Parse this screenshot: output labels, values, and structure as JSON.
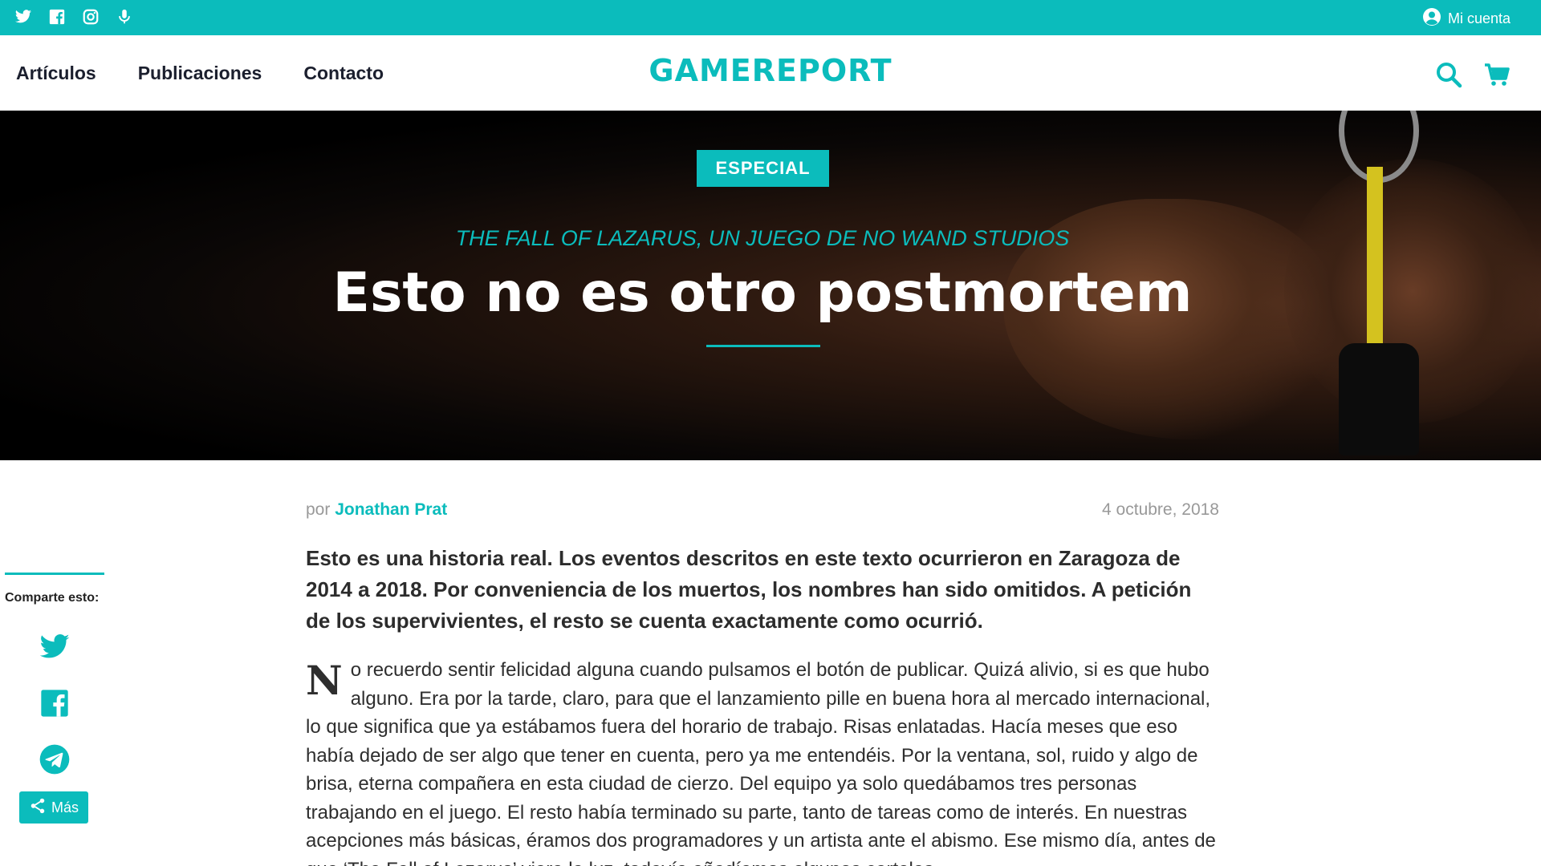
{
  "topbar": {
    "social_icons": [
      "twitter-icon",
      "facebook-icon",
      "instagram-icon",
      "microphone-icon"
    ],
    "account_label": "Mi cuenta"
  },
  "header": {
    "nav": [
      "Artículos",
      "Publicaciones",
      "Contacto"
    ],
    "logo": "GAMEREPORT",
    "icons": [
      "search-icon",
      "cart-icon"
    ]
  },
  "hero": {
    "badge": "ESPECIAL",
    "kicker": "THE FALL OF LAZARUS, UN JUEGO DE NO WAND STUDIOS",
    "title": "Esto no es otro postmortem"
  },
  "share": {
    "label": "Comparte esto:",
    "networks": [
      "twitter-icon",
      "facebook-icon",
      "telegram-icon"
    ],
    "more_label": "Más"
  },
  "article": {
    "by": "por",
    "author": "Jonathan Prat",
    "date": "4 octubre, 2018",
    "lead": "Esto es una historia real. Los eventos descritos en este texto ocurrieron en Zaragoza de 2014 a 2018. Por conveniencia de los muertos, los nombres han sido omitidos. A petición de los supervivientes, el resto se cuenta exactamente como ocurrió.",
    "dropcap": "N",
    "body": "o recuerdo sentir felicidad alguna cuando pulsamos el botón de publicar. Quizá alivio, si es que hubo alguno. Era por la tarde, claro, para que el lanzamiento pille en buena hora al mercado internacional, lo que significa que ya estábamos fuera del horario de trabajo. Risas enlatadas. Hacía meses que eso había dejado de ser algo que tener en cuenta, pero ya me entendéis. Por la ventana, sol, ruido y algo de brisa, eterna compañera en esta ciudad de cierzo. Del equipo ya solo quedábamos tres personas trabajando en el juego. El resto había terminado su parte, tanto de tareas como de interés. En nuestras acepciones más básicas, éramos dos programadores y un artista ante el abismo. Ese mismo día, antes de que ‘The Fall of Lazarus’ viera la luz, todavía añadíamos algunos carteles"
  },
  "colors": {
    "accent": "#0bbcbc",
    "nav_text": "#1b1f2e",
    "hero_bg": "#000000",
    "meta_grey": "#999999"
  }
}
